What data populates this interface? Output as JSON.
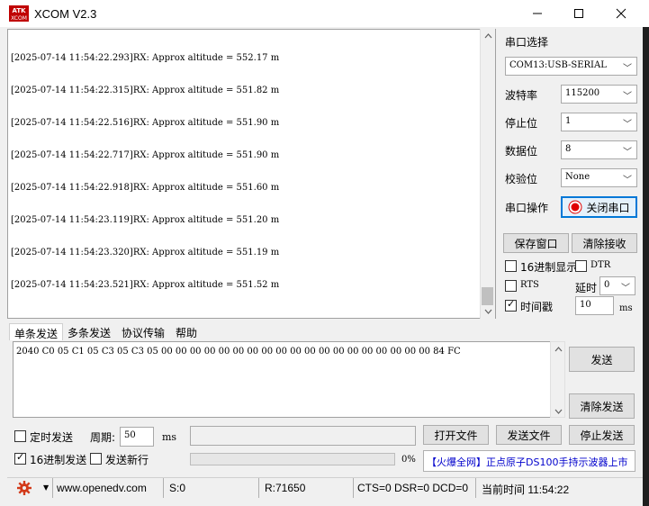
{
  "window": {
    "title": "XCOM V2.3",
    "logo_text": "ATK\nXCOM"
  },
  "receive": {
    "lines": [
      "[2025-07-14 11:54:22.293]RX: Approx altitude = 552.17 m",
      "[2025-07-14 11:54:22.315]RX: Approx altitude = 551.82 m",
      "[2025-07-14 11:54:22.516]RX: Approx altitude = 551.90 m",
      "[2025-07-14 11:54:22.717]RX: Approx altitude = 551.90 m",
      "[2025-07-14 11:54:22.918]RX: Approx altitude = 551.60 m",
      "[2025-07-14 11:54:23.119]RX: Approx altitude = 551.20 m",
      "[2025-07-14 11:54:23.320]RX: Approx altitude = 551.19 m",
      "[2025-07-14 11:54:23.521]RX: Approx altitude = 551.52 m"
    ]
  },
  "port": {
    "select_label": "串口选择",
    "port_value": "COM13:USB-SERIAL",
    "baud_label": "波特率",
    "baud_value": "115200",
    "stop_label": "停止位",
    "stop_value": "1",
    "data_label": "数据位",
    "data_value": "8",
    "parity_label": "校验位",
    "parity_value": "None",
    "op_label": "串口操作",
    "close_button": "关闭串口",
    "status_color": "#e00000"
  },
  "actions": {
    "save_window": "保存窗口",
    "clear_receive": "清除接收",
    "hex_display": "16进制显示",
    "dtr": "DTR",
    "rts": "RTS",
    "delay_label": "延时",
    "delay_value": "0",
    "timestamp": "时间戳",
    "timestamp_interval": "10",
    "ms": "ms"
  },
  "tabs": [
    "单条发送",
    "多条发送",
    "协议传输",
    "帮助"
  ],
  "send": {
    "text": "2040 C0 05 C1 05 C3 05 C3 05 00 00 00 00 00 00 00 00 00 00 00 00 00 00 00 00 00 00 00 84 FC",
    "send_button": "发送",
    "clear_send_button": "清除发送",
    "timed_send": "定时发送",
    "period_label": "周期:",
    "period_value": "50",
    "ms": "ms",
    "open_file": "打开文件",
    "send_file": "发送文件",
    "stop_send": "停止发送",
    "hex_send": "16进制发送",
    "send_newline": "发送新行",
    "progress": "0%",
    "promo": "【火爆全网】正点原子DS100手持示波器上市"
  },
  "statusbar": {
    "url": "www.openedv.com",
    "sent": "S:0",
    "received": "R:71650",
    "signals": "CTS=0 DSR=0 DCD=0",
    "time": "当前时间 11:54:22"
  }
}
